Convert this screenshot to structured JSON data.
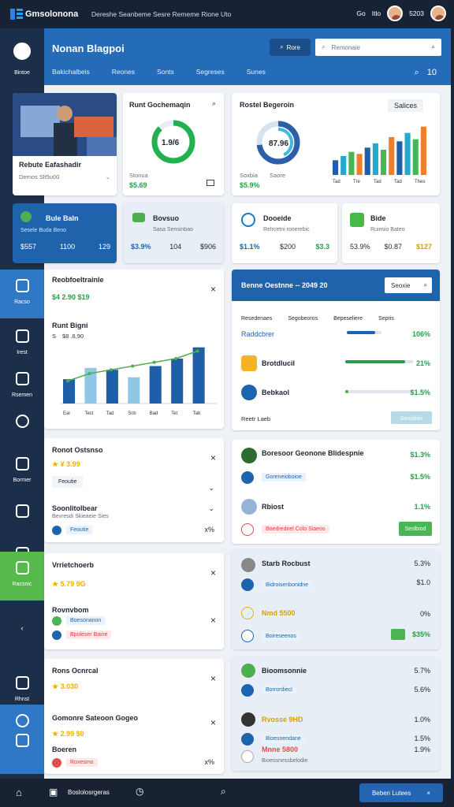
{
  "topbar": {
    "title": "Gmsolonona",
    "subtitle": "Dereshe Seanbeme Sesre Rememe Rione Uto",
    "time": "Go",
    "action": "Itlo",
    "score": "5203"
  },
  "sidebar": {
    "items": [
      {
        "label": "Bintoe"
      },
      {
        "label": "Racso"
      },
      {
        "label": "Irest"
      },
      {
        "label": "Rsemen"
      },
      {
        "label": "Bormer"
      },
      {
        "label": "Racsnic"
      },
      {
        "label": "Rhnst"
      }
    ]
  },
  "header": {
    "title": "Nonan Blagpoi",
    "filter_btn": "Rore",
    "search_placeholder": "Remonaie",
    "tabs": [
      "Bakichalbeis",
      "Reones",
      "Sonts",
      "Segreses",
      "Sunes"
    ],
    "count": "10"
  },
  "cards": {
    "profile": {
      "name": "Rebute Eafashadir",
      "meta": "Demos Slt5u00"
    },
    "donut1": {
      "title": "Runt Gochemaqin",
      "value": "1.9/6",
      "label": "Stonua",
      "amount": "$5.69"
    },
    "donut2": {
      "title": "Rostel Begeroin",
      "value": "87.96",
      "right": "Salices",
      "label1": "Soxbia",
      "label2": "Saore",
      "amount": "$5.9%"
    },
    "stats1": {
      "title": "Bule Baln",
      "sub": "Sesele  Buda Beno",
      "value1": "$557",
      "value2": "1100",
      "value3": "129"
    },
    "stats2": {
      "title": "Bovsuo",
      "sub": "Sasa Sensinbao",
      "value1": "$3.9%",
      "value2": "104",
      "value3": "$906"
    },
    "stats3": {
      "title": "Dooeide",
      "sub": "Relrcetni ronerebic",
      "value1": "$1.1%",
      "value2": "$200",
      "value3": "$3.3"
    },
    "stats4": {
      "title": "Bide",
      "sub": "Ruinsio  Bateo",
      "value1": "53.9%",
      "value2": "$0.87",
      "value3": "$127"
    },
    "chartcard": {
      "title": "Reobfoeltrainle",
      "sub": "$4  2.90  $19",
      "chart_title": "Runt Bigni",
      "small": "$8  .6,90",
      "icon": "S"
    },
    "table": {
      "title": "Benne Oestnne -- 2049 20",
      "button": "Seoxie",
      "headers": [
        "Resedenaes",
        "Segobeoros",
        "Bepeseliere",
        "Sepris"
      ],
      "rows": [
        {
          "name": "Raddcbrer",
          "value": "106%",
          "fill": 0.82,
          "color": "#1d64ae"
        },
        {
          "name": "Brotdlucil",
          "value": "21%",
          "fill": 0.88,
          "color": "#2a9e47"
        },
        {
          "name": "Bebkaol",
          "value": "$1.5%",
          "fill": 0.05,
          "color": "#4caf50"
        }
      ],
      "footer_label": "Reetr Laeb",
      "footer_btn": "Seosbier"
    },
    "list1": {
      "title": "Ronot Ostsnso",
      "stars": "★ ¥ 3.99",
      "chip": "Feoutie",
      "extra1": "Soonlitolbear",
      "extra2": "Bevresdi Skieaeie Sies",
      "value": "x%"
    },
    "list2": {
      "title": "Vrrietchoerb",
      "stars": "★ 5.79 9G",
      "chip": "Boesonanon",
      "label": "Rovnvbom",
      "extra": "Bpoleser Baine"
    },
    "list3": {
      "title": "Rons Ocnrcal",
      "stars": "★ 3.030",
      "label": "Gomonre Sateoon Gogeo",
      "stars2": "★ 2.99  $0",
      "chip": "Boeren",
      "extra": "Roxesmo"
    },
    "right1": {
      "title": "Boresoor Geonone Blidespnie",
      "value": "$1.3%",
      "chip": "Goreneioboioe",
      "value2": "$1.5%"
    },
    "right2": {
      "title": "Rbiost",
      "chip": "Boedrednel Colo Siaeos",
      "value": "1.1%",
      "btn": "Seslbiod"
    },
    "right3": {
      "title": "Starb Rocbust",
      "value": "5.3%",
      "value2": "$1.0",
      "chip": "Bidroisenbonidne"
    },
    "right4": {
      "title": "Nmd 5500",
      "value": "0%",
      "value2": "$35%",
      "chip": "Boireseenos"
    },
    "right5": {
      "title": "Bioomsonnie",
      "value": "5.7%",
      "value2": "5.6%",
      "chip": "Borrordiecl"
    },
    "right6": {
      "title": "Rvosse 9HD",
      "value": "1.0%",
      "value2": "1.5%",
      "chip": "Bioesnendane"
    },
    "right7": {
      "title": "Mnne 5800",
      "value": "1.9%",
      "chip": "Bioessnessbelodie"
    }
  },
  "chart_data": [
    {
      "type": "bar",
      "title": "Runt Bigni",
      "categories": [
        "Eal",
        "Tect",
        "Tad",
        "Scb",
        "Bad",
        "Tet",
        "Tab"
      ],
      "values": [
        13,
        19,
        18,
        14,
        20,
        24,
        30
      ],
      "series": [
        {
          "name": "Line",
          "values": [
            6,
            8,
            9,
            10,
            11,
            12,
            14
          ]
        }
      ]
    },
    {
      "type": "bar",
      "title": "Rostel Begeroin",
      "categories": [
        "Tad",
        "Tre",
        "Tad",
        "Tad",
        "Thes"
      ],
      "values": [
        7,
        9,
        11,
        10,
        13,
        15,
        12,
        18,
        16,
        20,
        17,
        23
      ]
    }
  ],
  "footer": {
    "label1": "Boslolosrgeras",
    "button": "Beben Lutees"
  },
  "colors": {
    "accent": "#246bb8",
    "green": "#49b555",
    "blue": "#1f63ad"
  }
}
